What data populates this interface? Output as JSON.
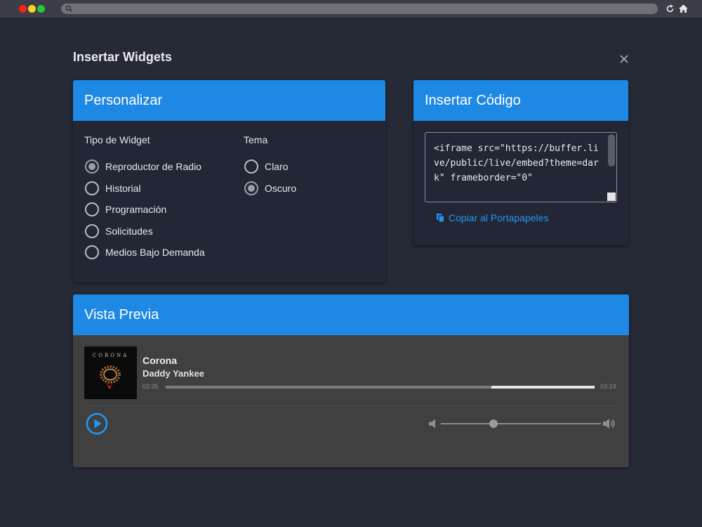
{
  "dialog": {
    "title": "Insertar Widgets"
  },
  "customize": {
    "header": "Personalizar",
    "widget_type_label": "Tipo de Widget",
    "widget_types": [
      {
        "label": "Reproductor de Radio",
        "checked": true
      },
      {
        "label": "Historial",
        "checked": false
      },
      {
        "label": "Programación",
        "checked": false
      },
      {
        "label": "Solicitudes",
        "checked": false
      },
      {
        "label": "Medios Bajo Demanda",
        "checked": false
      }
    ],
    "theme_label": "Tema",
    "themes": [
      {
        "label": "Claro",
        "checked": false
      },
      {
        "label": "Oscuro",
        "checked": true
      }
    ]
  },
  "embed": {
    "header": "Insertar Código",
    "code": "<iframe src=\"https://buffer.live/public/live/embed?theme=dark\" frameborder=\"0\"",
    "copy_label": "Copiar al Portapapeles"
  },
  "preview": {
    "header": "Vista Previa",
    "cover_text": "CORONA",
    "track_title": "Corona",
    "track_artist": "Daddy Yankee",
    "current_time": "02:35",
    "duration": "03:24",
    "progress_fraction": 0.76,
    "buffer_end_fraction": 1.0,
    "volume_fraction": 0.33
  },
  "colors": {
    "accent": "#1e88e5",
    "link": "#2196f3",
    "background": "#262a36",
    "card": "#232735",
    "player": "#404040"
  }
}
